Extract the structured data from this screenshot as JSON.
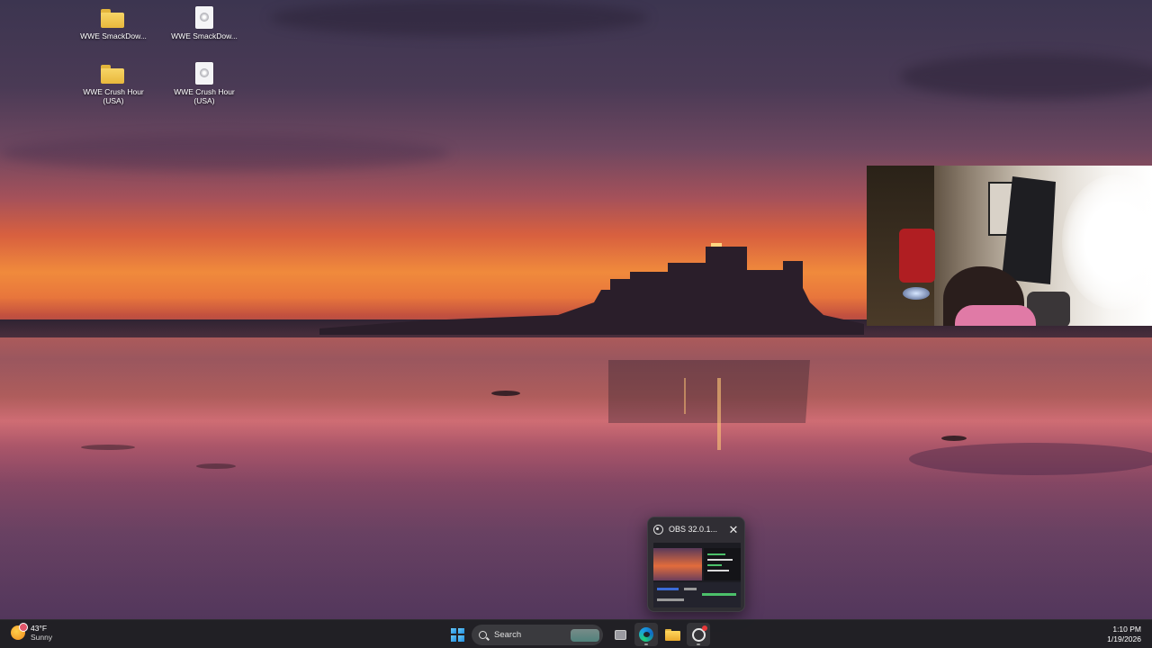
{
  "desktop": {
    "icons": [
      {
        "label": "WWE SmackDow...",
        "type": "folder"
      },
      {
        "label": "WWE SmackDow...",
        "type": "file"
      },
      {
        "label": "WWE Crush Hour (USA)",
        "type": "folder"
      },
      {
        "label": "WWE Crush Hour (USA)",
        "type": "file"
      }
    ]
  },
  "preview": {
    "app_icon": "obs-icon",
    "title": "OBS 32.0.1...",
    "close_glyph": "✕"
  },
  "taskbar": {
    "weather": {
      "temp": "43°F",
      "condition": "Sunny",
      "icon": "sun-icon"
    },
    "search": {
      "placeholder": "Search"
    },
    "apps": [
      "start-icon",
      "task-view-icon",
      "edge-icon",
      "file-explorer-icon",
      "obs-icon"
    ],
    "clock": {
      "time": "1:10 PM",
      "date": "1/19/2026"
    }
  },
  "colors": {
    "taskbar_bg": "#202024",
    "accent_blue": "#1f8ee0",
    "notification_red": "#e8393a"
  }
}
